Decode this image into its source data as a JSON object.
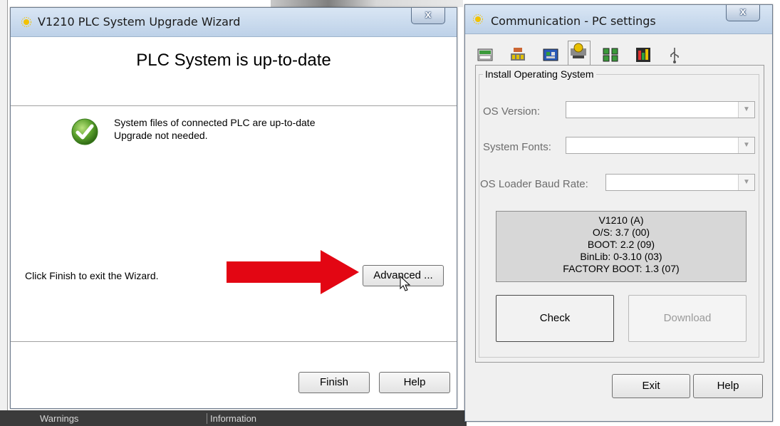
{
  "wizard": {
    "title": "V1210 PLC System Upgrade Wizard",
    "close_label": "x",
    "heading": "PLC System is up-to-date",
    "status_line1": "System files of connected PLC are up-to-date",
    "status_line2": "Upgrade not needed.",
    "exit_hint": "Click Finish to exit the Wizard.",
    "advanced_label": "Advanced ...",
    "finish_label": "Finish",
    "help_label": "Help"
  },
  "comm": {
    "title": "Communication - PC settings",
    "close_label": "x",
    "tabs": [
      "plc-tab-icon",
      "network-tab-icon",
      "modem-tab-icon",
      "os-tab-icon",
      "ethernet-tab-icon",
      "gprs-tab-icon",
      "usb-tab-icon"
    ],
    "group_title": "Install Operating System",
    "os_version_label": "OS Version:",
    "os_version_value": "",
    "system_fonts_label": "System Fonts:",
    "system_fonts_value": "",
    "baud_rate_label": "OS Loader Baud Rate:",
    "baud_rate_value": "",
    "info_lines": [
      "V1210 (A)",
      "O/S: 3.7 (00)",
      "BOOT: 2.2 (09)",
      "BinLib: 0-3.10 (03)",
      "FACTORY BOOT: 1.3 (07)"
    ],
    "check_label": "Check",
    "download_label": "Download",
    "exit_label": "Exit",
    "help_label": "Help"
  },
  "background": {
    "warnings_label": "Warnings",
    "information_label": "Information"
  },
  "colors": {
    "arrow_red": "#e30613",
    "titlebar": "#c7d8ec",
    "info_panel": "#d7d7d7",
    "check_green": "#5aa02c"
  }
}
